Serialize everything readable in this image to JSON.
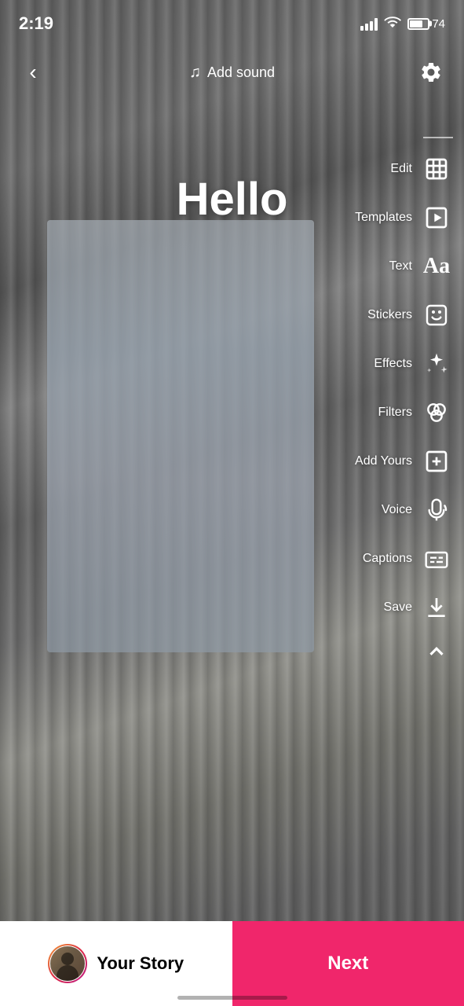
{
  "statusBar": {
    "time": "2:19",
    "battery": "74",
    "batteryPercent": 74
  },
  "topBar": {
    "addSound": "Add sound",
    "backLabel": "Back"
  },
  "mainContent": {
    "helloText": "Hello"
  },
  "toolbar": {
    "items": [
      {
        "id": "edit",
        "label": "Edit",
        "icon": "edit-icon"
      },
      {
        "id": "templates",
        "label": "Templates",
        "icon": "templates-icon"
      },
      {
        "id": "text",
        "label": "Text",
        "icon": "text-icon"
      },
      {
        "id": "stickers",
        "label": "Stickers",
        "icon": "stickers-icon"
      },
      {
        "id": "effects",
        "label": "Effects",
        "icon": "effects-icon"
      },
      {
        "id": "filters",
        "label": "Filters",
        "icon": "filters-icon"
      },
      {
        "id": "addyours",
        "label": "Add Yours",
        "icon": "addyours-icon"
      },
      {
        "id": "voice",
        "label": "Voice",
        "icon": "voice-icon"
      },
      {
        "id": "captions",
        "label": "Captions",
        "icon": "captions-icon"
      },
      {
        "id": "save",
        "label": "Save",
        "icon": "save-icon"
      }
    ]
  },
  "bottomBar": {
    "yourStory": "Your Story",
    "next": "Next"
  }
}
